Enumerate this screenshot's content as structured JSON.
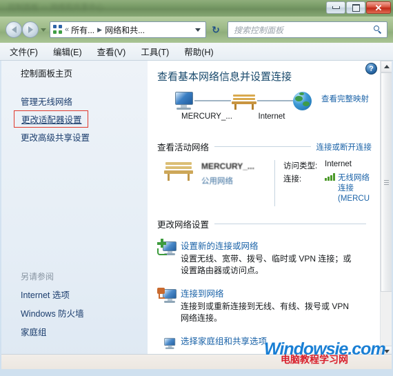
{
  "window": {
    "title_blurred": "控制面板 — 网络和共享中心",
    "controls": {
      "minimize": "最小化",
      "maximize": "最大化",
      "close": "关闭"
    }
  },
  "addressbar": {
    "back": "后退",
    "forward": "前进",
    "history_dropdown": "最近浏览的位置",
    "icon": "control-panel-icon",
    "crumb_sep": "«",
    "crumb_root": "所有...",
    "crumb_arrow": "▶",
    "crumb_current": "网络和共...",
    "crumb_dropdown": "▼",
    "refresh": "↻"
  },
  "search": {
    "placeholder": "搜索控制面板",
    "icon": "search-icon"
  },
  "menubar": {
    "items": [
      {
        "label": "文件(F)"
      },
      {
        "label": "编辑(E)"
      },
      {
        "label": "查看(V)"
      },
      {
        "label": "工具(T)"
      },
      {
        "label": "帮助(H)"
      }
    ]
  },
  "sidebar": {
    "home": "控制面板主页",
    "items": [
      {
        "label": "管理无线网络",
        "highlighted": false
      },
      {
        "label": "更改适配器设置",
        "highlighted": true
      },
      {
        "label": "更改高级共享设置",
        "highlighted": false
      }
    ],
    "see_also_header": "另请参阅",
    "see_also": [
      {
        "label": "Internet 选项"
      },
      {
        "label": "Windows 防火墙"
      },
      {
        "label": "家庭组"
      }
    ]
  },
  "main": {
    "help_button": "?",
    "page_title": "查看基本网络信息并设置连接",
    "network_map": {
      "full_map_link": "查看完整映射",
      "computer_icon": "computer-monitor-icon",
      "network_icon": "public-network-bench-icon",
      "internet_icon": "globe-icon",
      "label_network": "MERCURY_...",
      "label_internet": "Internet"
    },
    "active_networks": {
      "header": "查看活动网络",
      "action_link": "连接或断开连接",
      "network_name": "MERCURY_...",
      "network_type": "公用网络",
      "access_type_key": "访问类型:",
      "access_type_value": "Internet",
      "connection_key": "连接:",
      "connection_value_lines": [
        "无线网络",
        "连接",
        "(MERCU"
      ],
      "signal_icon": "wireless-signal-icon"
    },
    "change_settings": {
      "header": "更改网络设置",
      "items": [
        {
          "icon": "new-connection-icon",
          "title": "设置新的连接或网络",
          "desc_lines": [
            "设置无线、宽带、拨号、临时或 VPN 连接；或",
            "设置路由器或访问点。"
          ]
        },
        {
          "icon": "connect-to-network-icon",
          "title": "连接到网络",
          "desc_lines": [
            "连接到或重新连接到无线、有线、拨号或 VPN",
            "网络连接。"
          ]
        },
        {
          "icon": "homegroup-sharing-icon",
          "title": "选择家庭组和共享选项",
          "desc_lines": []
        }
      ]
    }
  },
  "scrollbar": {
    "up": "▲",
    "down": "▼"
  },
  "watermark": {
    "primary": "Windowsie.com",
    "secondary": "电脑教程学习网"
  }
}
